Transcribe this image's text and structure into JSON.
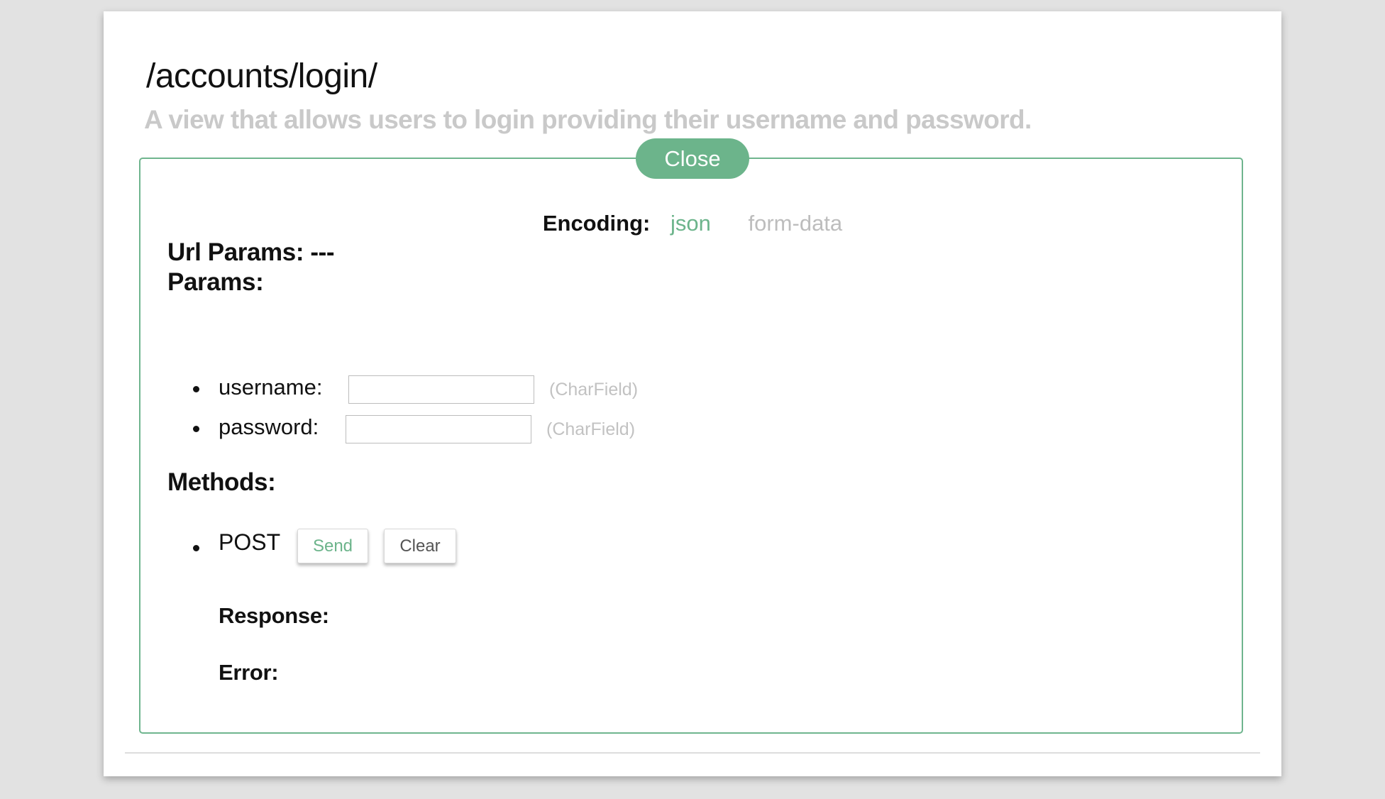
{
  "endpoint": {
    "path": "/accounts/login/",
    "description": "A view that allows users to login providing their username and password."
  },
  "close_label": "Close",
  "encoding": {
    "label": "Encoding:",
    "options": [
      "json",
      "form-data"
    ],
    "selected": "json"
  },
  "url_params": {
    "label": "Url Params: ---"
  },
  "params": {
    "label": "Params:",
    "items": [
      {
        "name": "username:",
        "type": "(CharField)",
        "value": ""
      },
      {
        "name": "password:",
        "type": "(CharField)",
        "value": ""
      }
    ]
  },
  "methods": {
    "label": "Methods:",
    "items": [
      {
        "method": "POST",
        "send_label": "Send",
        "clear_label": "Clear"
      }
    ]
  },
  "response_label": "Response:",
  "error_label": "Error:",
  "colors": {
    "accent": "#6cb48b",
    "panel_border": "#6fb58e",
    "muted_text": "#c9c9c9",
    "background": "#e2e2e2"
  }
}
